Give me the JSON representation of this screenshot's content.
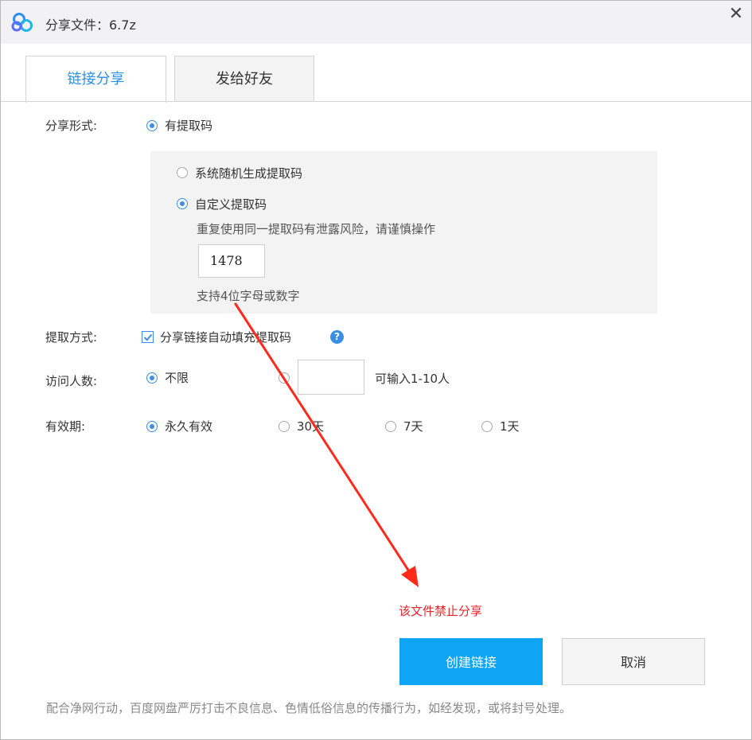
{
  "window": {
    "title": "分享文件：6.7z",
    "close_symbol": "✕"
  },
  "tabs": [
    {
      "label": "链接分享",
      "active": true
    },
    {
      "label": "发给好友",
      "active": false
    }
  ],
  "share_form": {
    "label": "分享形式:",
    "option": "有提取码",
    "sub_options": [
      {
        "label": "系统随机生成提取码",
        "selected": false
      },
      {
        "label": "自定义提取码",
        "selected": true
      }
    ],
    "warning_note": "重复使用同一提取码有泄露风险，请谨慎操作",
    "code_value": "1478",
    "code_hint": "支持4位字母或数字"
  },
  "extract_method": {
    "label": "提取方式:",
    "checkbox_label": "分享链接自动填充提取码",
    "checked": true,
    "help_icon": "?"
  },
  "visitors": {
    "label": "访问人数:",
    "unlimited": "不限",
    "input_value": "",
    "input_hint": "可输入1-10人"
  },
  "validity": {
    "label": "有效期:",
    "options": [
      "永久有效",
      "30天",
      "7天",
      "1天"
    ],
    "selected": "永久有效"
  },
  "error_message": "该文件禁止分享",
  "buttons": {
    "create": "创建链接",
    "cancel": "取消"
  },
  "footer_note": "配合净网行动，百度网盘严厉打击不良信息、色情低俗信息的传播行为，如经发现，或将封号处理。",
  "colors": {
    "accent": "#2b8fe5",
    "primary_button": "#0fa5f5",
    "error": "#e3242b",
    "annotation_arrow": "#ff2a1a"
  },
  "icons": {
    "logo": "baidu-netdisk-logo",
    "close": "close-icon",
    "help": "question-icon",
    "annotation": "red-arrow"
  }
}
